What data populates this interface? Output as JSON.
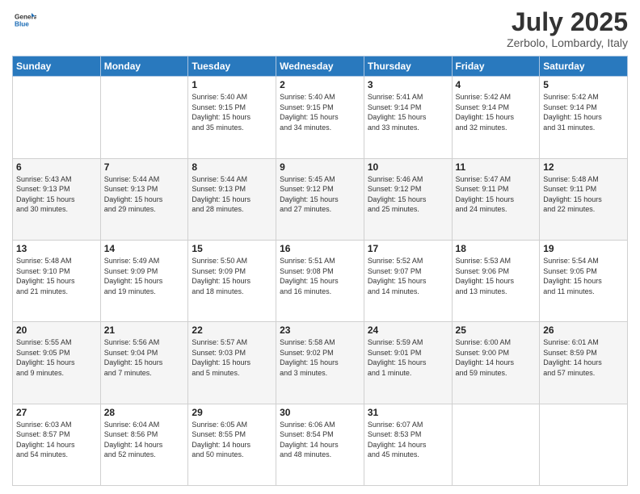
{
  "header": {
    "logo_line1": "General",
    "logo_line2": "Blue",
    "month_title": "July 2025",
    "location": "Zerbolo, Lombardy, Italy"
  },
  "days_of_week": [
    "Sunday",
    "Monday",
    "Tuesday",
    "Wednesday",
    "Thursday",
    "Friday",
    "Saturday"
  ],
  "weeks": [
    [
      {
        "day": "",
        "info": ""
      },
      {
        "day": "",
        "info": ""
      },
      {
        "day": "1",
        "info": "Sunrise: 5:40 AM\nSunset: 9:15 PM\nDaylight: 15 hours\nand 35 minutes."
      },
      {
        "day": "2",
        "info": "Sunrise: 5:40 AM\nSunset: 9:15 PM\nDaylight: 15 hours\nand 34 minutes."
      },
      {
        "day": "3",
        "info": "Sunrise: 5:41 AM\nSunset: 9:14 PM\nDaylight: 15 hours\nand 33 minutes."
      },
      {
        "day": "4",
        "info": "Sunrise: 5:42 AM\nSunset: 9:14 PM\nDaylight: 15 hours\nand 32 minutes."
      },
      {
        "day": "5",
        "info": "Sunrise: 5:42 AM\nSunset: 9:14 PM\nDaylight: 15 hours\nand 31 minutes."
      }
    ],
    [
      {
        "day": "6",
        "info": "Sunrise: 5:43 AM\nSunset: 9:13 PM\nDaylight: 15 hours\nand 30 minutes."
      },
      {
        "day": "7",
        "info": "Sunrise: 5:44 AM\nSunset: 9:13 PM\nDaylight: 15 hours\nand 29 minutes."
      },
      {
        "day": "8",
        "info": "Sunrise: 5:44 AM\nSunset: 9:13 PM\nDaylight: 15 hours\nand 28 minutes."
      },
      {
        "day": "9",
        "info": "Sunrise: 5:45 AM\nSunset: 9:12 PM\nDaylight: 15 hours\nand 27 minutes."
      },
      {
        "day": "10",
        "info": "Sunrise: 5:46 AM\nSunset: 9:12 PM\nDaylight: 15 hours\nand 25 minutes."
      },
      {
        "day": "11",
        "info": "Sunrise: 5:47 AM\nSunset: 9:11 PM\nDaylight: 15 hours\nand 24 minutes."
      },
      {
        "day": "12",
        "info": "Sunrise: 5:48 AM\nSunset: 9:11 PM\nDaylight: 15 hours\nand 22 minutes."
      }
    ],
    [
      {
        "day": "13",
        "info": "Sunrise: 5:48 AM\nSunset: 9:10 PM\nDaylight: 15 hours\nand 21 minutes."
      },
      {
        "day": "14",
        "info": "Sunrise: 5:49 AM\nSunset: 9:09 PM\nDaylight: 15 hours\nand 19 minutes."
      },
      {
        "day": "15",
        "info": "Sunrise: 5:50 AM\nSunset: 9:09 PM\nDaylight: 15 hours\nand 18 minutes."
      },
      {
        "day": "16",
        "info": "Sunrise: 5:51 AM\nSunset: 9:08 PM\nDaylight: 15 hours\nand 16 minutes."
      },
      {
        "day": "17",
        "info": "Sunrise: 5:52 AM\nSunset: 9:07 PM\nDaylight: 15 hours\nand 14 minutes."
      },
      {
        "day": "18",
        "info": "Sunrise: 5:53 AM\nSunset: 9:06 PM\nDaylight: 15 hours\nand 13 minutes."
      },
      {
        "day": "19",
        "info": "Sunrise: 5:54 AM\nSunset: 9:05 PM\nDaylight: 15 hours\nand 11 minutes."
      }
    ],
    [
      {
        "day": "20",
        "info": "Sunrise: 5:55 AM\nSunset: 9:05 PM\nDaylight: 15 hours\nand 9 minutes."
      },
      {
        "day": "21",
        "info": "Sunrise: 5:56 AM\nSunset: 9:04 PM\nDaylight: 15 hours\nand 7 minutes."
      },
      {
        "day": "22",
        "info": "Sunrise: 5:57 AM\nSunset: 9:03 PM\nDaylight: 15 hours\nand 5 minutes."
      },
      {
        "day": "23",
        "info": "Sunrise: 5:58 AM\nSunset: 9:02 PM\nDaylight: 15 hours\nand 3 minutes."
      },
      {
        "day": "24",
        "info": "Sunrise: 5:59 AM\nSunset: 9:01 PM\nDaylight: 15 hours\nand 1 minute."
      },
      {
        "day": "25",
        "info": "Sunrise: 6:00 AM\nSunset: 9:00 PM\nDaylight: 14 hours\nand 59 minutes."
      },
      {
        "day": "26",
        "info": "Sunrise: 6:01 AM\nSunset: 8:59 PM\nDaylight: 14 hours\nand 57 minutes."
      }
    ],
    [
      {
        "day": "27",
        "info": "Sunrise: 6:03 AM\nSunset: 8:57 PM\nDaylight: 14 hours\nand 54 minutes."
      },
      {
        "day": "28",
        "info": "Sunrise: 6:04 AM\nSunset: 8:56 PM\nDaylight: 14 hours\nand 52 minutes."
      },
      {
        "day": "29",
        "info": "Sunrise: 6:05 AM\nSunset: 8:55 PM\nDaylight: 14 hours\nand 50 minutes."
      },
      {
        "day": "30",
        "info": "Sunrise: 6:06 AM\nSunset: 8:54 PM\nDaylight: 14 hours\nand 48 minutes."
      },
      {
        "day": "31",
        "info": "Sunrise: 6:07 AM\nSunset: 8:53 PM\nDaylight: 14 hours\nand 45 minutes."
      },
      {
        "day": "",
        "info": ""
      },
      {
        "day": "",
        "info": ""
      }
    ]
  ]
}
